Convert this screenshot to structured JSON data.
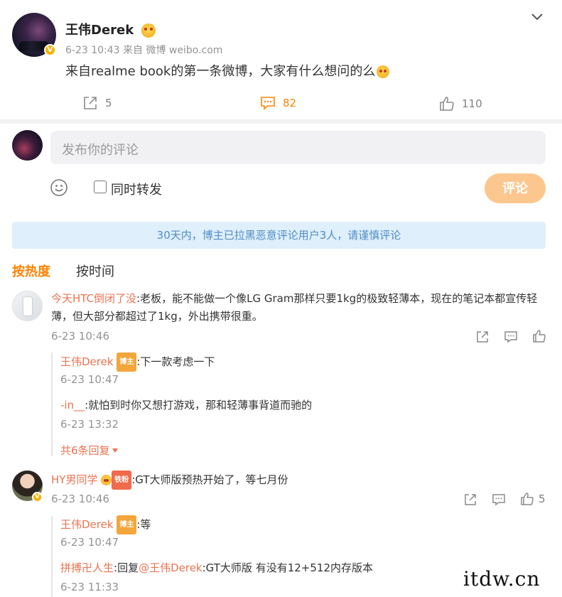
{
  "post": {
    "author": "王伟Derek",
    "meta": "6-23 10:43  来自 微博 weibo.com",
    "text": "来自realme book的第一条微博，大家有什么想问的么",
    "reposts": "5",
    "comments": "82",
    "likes": "110",
    "verified_badge": "V"
  },
  "composer": {
    "placeholder": "发布你的评论",
    "repost_label": "同时转发",
    "submit_label": "评论",
    "submit_color": "#fcc78f"
  },
  "notice": "30天内，博主已拉黑恶意评论用户3人，请谨慎评论",
  "sort": {
    "hot": "按热度",
    "time": "按时间",
    "accent": "#ff8200"
  },
  "comments": [
    {
      "user": "今天HTC倒闭了没",
      "text": ":老板，能不能做一个像LG Gram那样只要1kg的极致轻薄本，现在的笔记本都宣传轻",
      "text2": "薄，但大部分都超过了1kg，外出携带很重。",
      "time": "6-23 10:46",
      "replies": [
        {
          "user": "王伟Derek",
          "tag": "博主",
          "text": ":下一款考虑一下",
          "time": "6-23 10:47"
        },
        {
          "user": "-in__",
          "text": ":就怕到时你又想打游戏，那和轻薄事背道而驰的",
          "time": "6-23 13:32"
        }
      ],
      "more": "共6条回复"
    },
    {
      "user": "HY男同学",
      "tag": "铁粉",
      "text": ":GT大师版预热开始了，等七月份",
      "time": "6-23 10:46",
      "likes": "5",
      "replies": [
        {
          "user": "王伟Derek",
          "tag": "博主",
          "text": ":等",
          "time": "6-23 10:47"
        },
        {
          "user": "拼搏卍人生",
          "text": ":回复",
          "mention": "@王伟Derek",
          "text2": ":GT大师版 有没有12+512内存版本",
          "time": "6-23 11:33"
        }
      ]
    }
  ],
  "watermark": "itdw.cn",
  "icons": [
    "chevron-down-icon",
    "share-icon",
    "comment-icon",
    "like-icon",
    "smile-icon",
    "verified-badge-icon"
  ]
}
